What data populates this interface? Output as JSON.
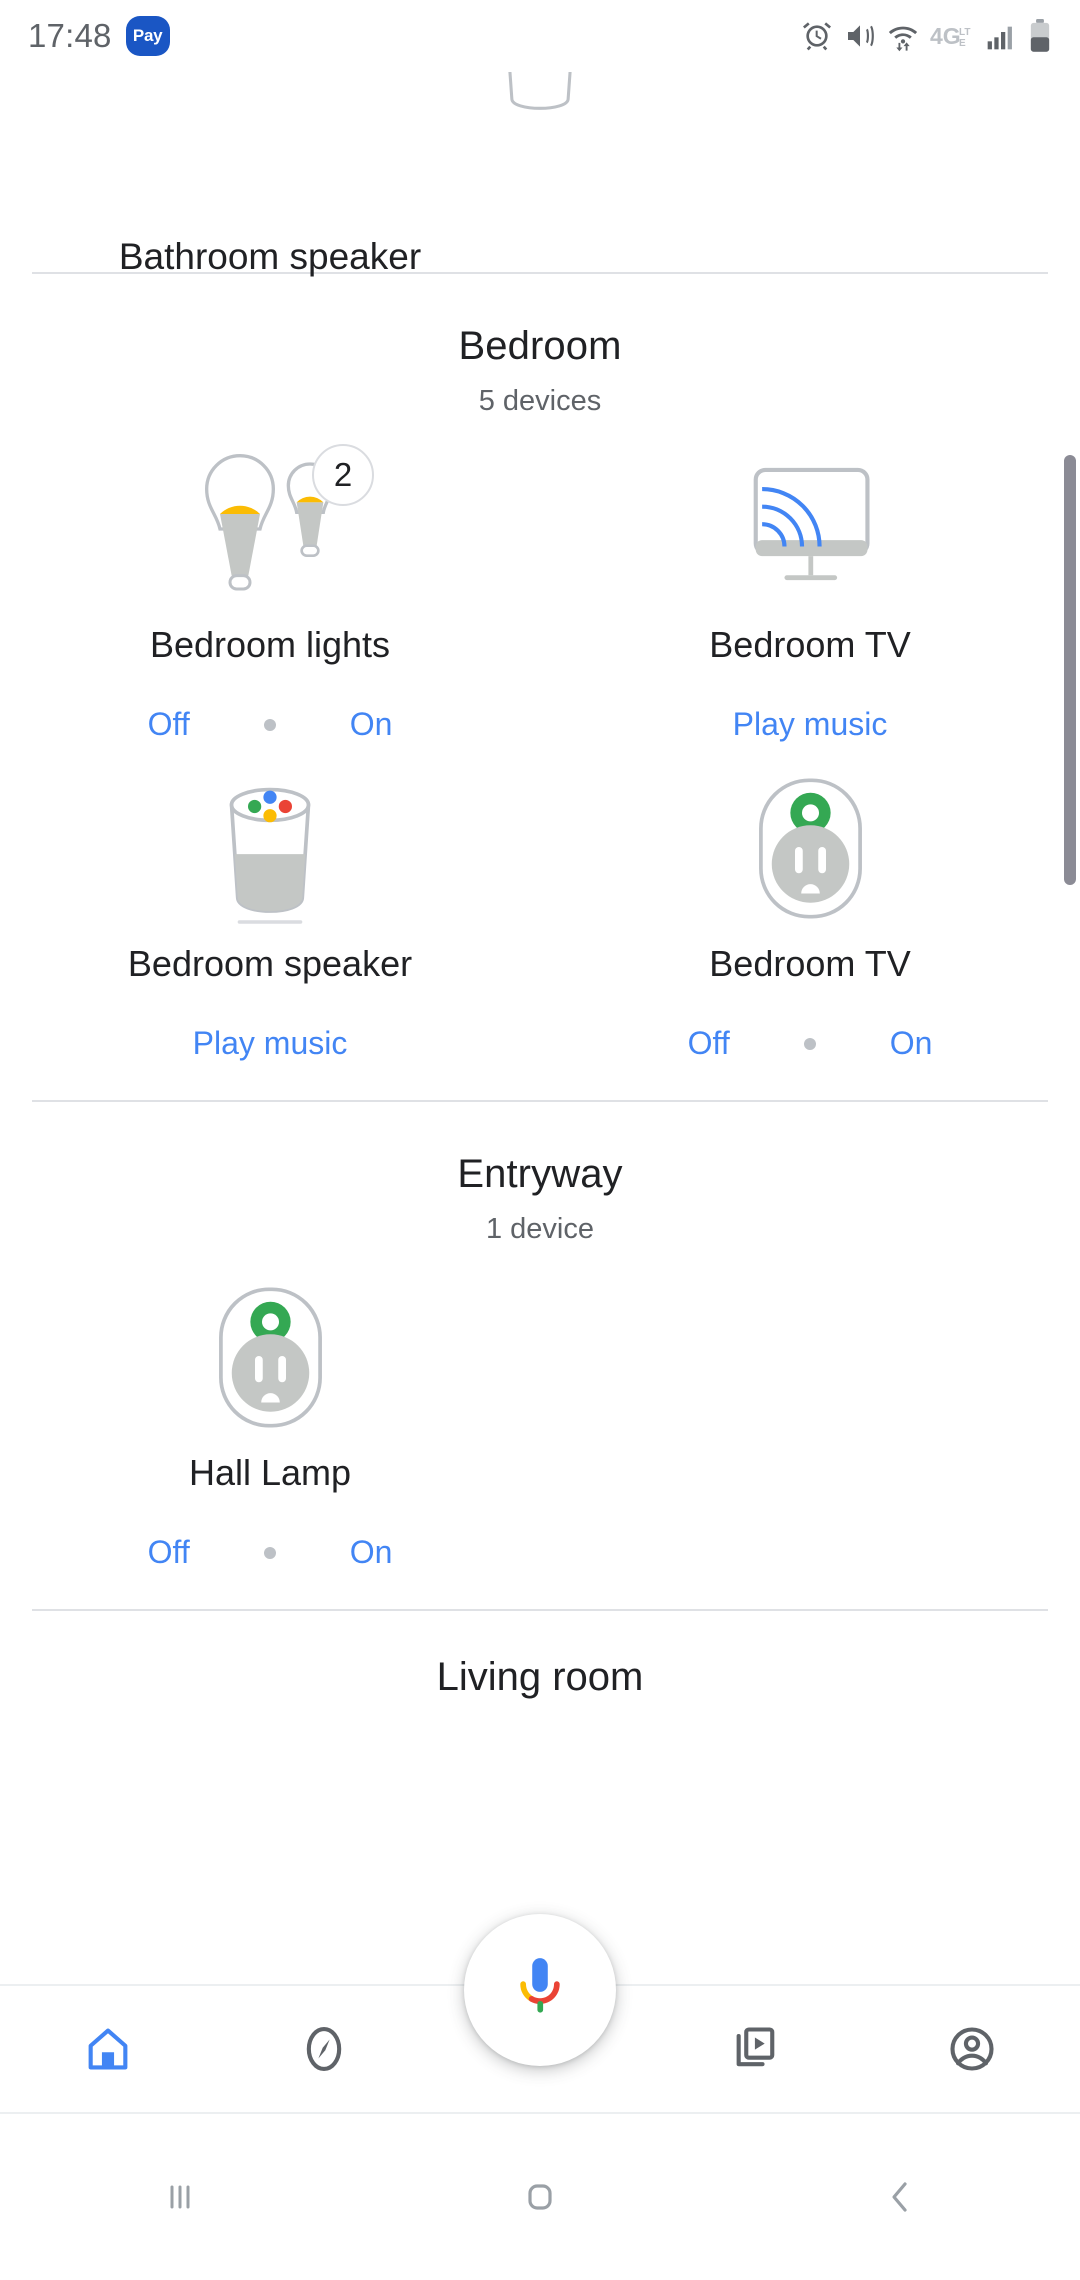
{
  "status_bar": {
    "clock": "17:48",
    "pay_badge": "Pay",
    "icons": [
      "alarm-clock-icon",
      "vibrate-mute-icon",
      "wifi-data-icon",
      "4g-lte-icon",
      "signal-bars-icon",
      "battery-icon"
    ]
  },
  "colors": {
    "accent_blue": "#4285f4",
    "bulb_yellow": "#fbbc04",
    "plug_green": "#34a853",
    "text_primary": "#202124",
    "text_secondary": "#5f6368",
    "divider": "#dfe1e5",
    "icon_gray": "#c4c7c5",
    "pay_blue": "#1a56c4"
  },
  "partial_device_top": {
    "name": "Bathroom speaker",
    "icon": "google-home-speaker-icon"
  },
  "rooms": [
    {
      "id": "bedroom",
      "title": "Bedroom",
      "device_count_label": "5 devices",
      "devices": [
        {
          "name": "Bedroom lights",
          "icon": "light-bulbs-icon",
          "badge": "2",
          "control_type": "toggle",
          "off_label": "Off",
          "on_label": "On"
        },
        {
          "name": "Bedroom TV",
          "icon": "cast-tv-icon",
          "badge": null,
          "control_type": "action",
          "action_label": "Play music"
        },
        {
          "name": "Bedroom speaker",
          "icon": "google-home-speaker-icon",
          "badge": null,
          "control_type": "action",
          "action_label": "Play music"
        },
        {
          "name": "Bedroom TV",
          "icon": "smart-plug-icon",
          "badge": null,
          "control_type": "toggle",
          "off_label": "Off",
          "on_label": "On"
        }
      ]
    },
    {
      "id": "entryway",
      "title": "Entryway",
      "device_count_label": "1 device",
      "devices": [
        {
          "name": "Hall Lamp",
          "icon": "smart-plug-icon",
          "badge": null,
          "control_type": "toggle",
          "off_label": "Off",
          "on_label": "On"
        }
      ]
    }
  ],
  "partial_room_bottom": {
    "title": "Living room"
  },
  "assistant_fab": {
    "icon": "google-assistant-mic-icon"
  },
  "bottom_nav": {
    "items": [
      {
        "id": "home",
        "icon": "home-icon",
        "active": true
      },
      {
        "id": "explore",
        "icon": "compass-icon",
        "active": false
      },
      {
        "id": "media",
        "icon": "media-cast-icon",
        "active": false
      },
      {
        "id": "account",
        "icon": "account-circle-icon",
        "active": false
      }
    ]
  },
  "android_nav": {
    "items": [
      {
        "id": "recents",
        "icon": "recents-icon"
      },
      {
        "id": "home",
        "icon": "home-square-icon"
      },
      {
        "id": "back",
        "icon": "back-chevron-icon"
      }
    ]
  }
}
